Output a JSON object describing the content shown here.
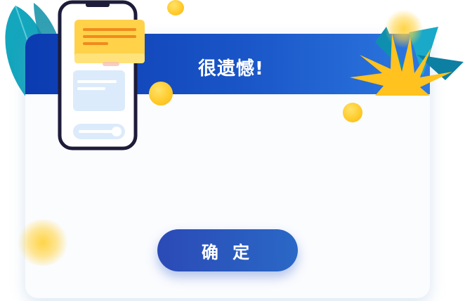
{
  "dialog": {
    "title": "很遗憾!",
    "confirm_label": "确 定"
  },
  "colors": {
    "header_start": "#0b3bb0",
    "header_end": "#2d78e0",
    "button_start": "#2b4ab6",
    "button_end": "#2a68c6",
    "card_background": "#fbfcfe",
    "coin": "#ffc928",
    "leaf": "#12a3b8",
    "star": "#ffc21e"
  },
  "icons": {
    "phone": "phone-illustration-icon",
    "leaf": "leaf-decoration-icon",
    "star": "star-burst-icon",
    "coin": "coin-icon"
  }
}
